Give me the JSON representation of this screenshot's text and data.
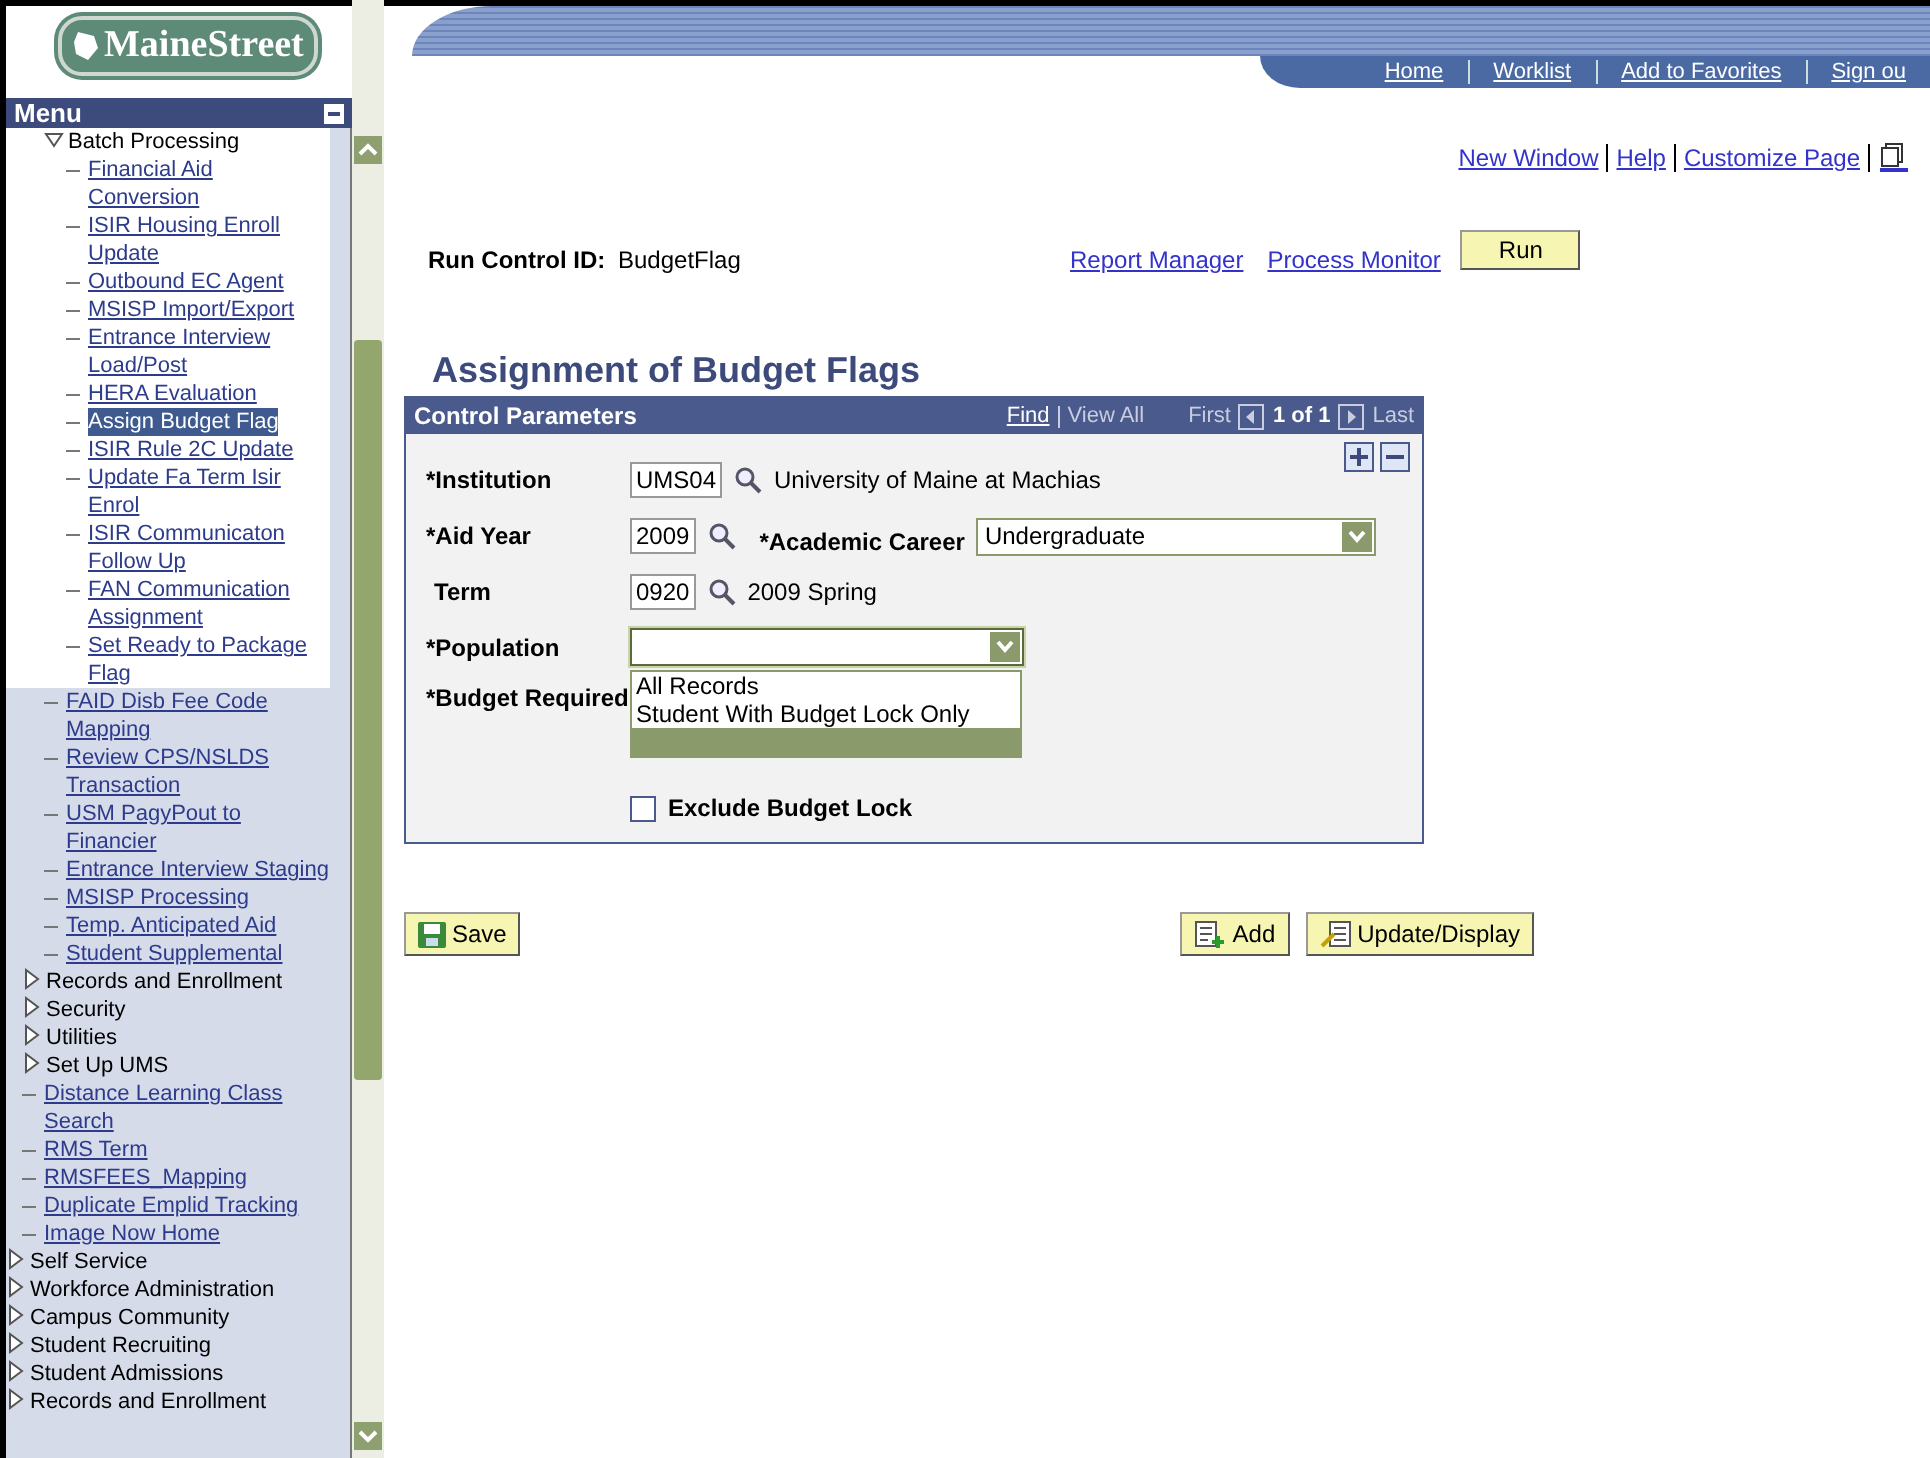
{
  "logo": {
    "text": "MaineStreet"
  },
  "header_nav": [
    "Home",
    "Worklist",
    "Add to Favorites",
    "Sign ou"
  ],
  "menu": {
    "title": "Menu",
    "items": [
      {
        "children": [
          {
            "children": [
              {
                "label": "Batch Processing",
                "kind": "folder",
                "expanded": true,
                "children": [
                  {
                    "label": "Financial Aid Conversion",
                    "kind": "link",
                    "selected": false
                  },
                  {
                    "label": "ISIR Housing Enroll Update",
                    "kind": "link",
                    "selected": false
                  },
                  {
                    "label": "Outbound EC Agent",
                    "kind": "link",
                    "selected": false
                  },
                  {
                    "label": "MSISP Import/Export",
                    "kind": "link",
                    "selected": false
                  },
                  {
                    "label": "Entrance Interview Load/Post",
                    "kind": "link",
                    "selected": false
                  },
                  {
                    "label": "HERA Evaluation",
                    "kind": "link",
                    "selected": false
                  },
                  {
                    "label": "Assign Budget Flag",
                    "kind": "link",
                    "selected": true
                  },
                  {
                    "label": "ISIR Rule 2C Update",
                    "kind": "link",
                    "selected": false
                  },
                  {
                    "label": "Update Fa Term Isir Enrol",
                    "kind": "link",
                    "selected": false
                  },
                  {
                    "label": "ISIR Communicaton Follow Up",
                    "kind": "link",
                    "selected": false
                  },
                  {
                    "label": "FAN Communication Assignment",
                    "kind": "link",
                    "selected": false
                  },
                  {
                    "label": "Set Ready to Package Flag",
                    "kind": "link",
                    "selected": false
                  }
                ]
              },
              {
                "label": "FAID Disb Fee Code Mapping",
                "kind": "link",
                "selected": false
              },
              {
                "label": "Review CPS/NSLDS Transaction",
                "kind": "link",
                "selected": false
              },
              {
                "label": "USM PagyPout to Financier",
                "kind": "link",
                "selected": false
              },
              {
                "label": "Entrance Interview Staging",
                "kind": "link",
                "selected": false
              },
              {
                "label": "MSISP Processing",
                "kind": "link",
                "selected": false
              },
              {
                "label": "Temp. Anticipated Aid",
                "kind": "link",
                "selected": false
              },
              {
                "label": "Student Supplemental",
                "kind": "link",
                "selected": false
              }
            ]
          },
          {
            "label": "Records and Enrollment",
            "kind": "folder",
            "expanded": false
          },
          {
            "label": "Security",
            "kind": "folder",
            "expanded": false
          },
          {
            "label": "Utilities",
            "kind": "folder",
            "expanded": false
          },
          {
            "label": "Set Up UMS",
            "kind": "folder",
            "expanded": false
          },
          {
            "label": "Distance Learning Class Search",
            "kind": "link",
            "selected": false
          },
          {
            "label": "RMS Term",
            "kind": "link",
            "selected": false
          },
          {
            "label": "RMSFEES_Mapping",
            "kind": "link",
            "selected": false
          },
          {
            "label": "Duplicate Emplid Tracking",
            "kind": "link",
            "selected": false
          },
          {
            "label": "Image Now Home",
            "kind": "link",
            "selected": false
          }
        ]
      },
      {
        "label": "Self Service",
        "kind": "folder",
        "expanded": false
      },
      {
        "label": "Workforce Administration",
        "kind": "folder",
        "expanded": false
      },
      {
        "label": "Campus Community",
        "kind": "folder",
        "expanded": false
      },
      {
        "label": "Student Recruiting",
        "kind": "folder",
        "expanded": false
      },
      {
        "label": "Student Admissions",
        "kind": "folder",
        "expanded": false
      },
      {
        "label": "Records and Enrollment",
        "kind": "folder",
        "expanded": false
      }
    ]
  },
  "page_links": [
    "New Window",
    "Help",
    "Customize Page"
  ],
  "run_control": {
    "label": "Run Control ID:",
    "value": "BudgetFlag",
    "links": [
      "Report Manager",
      "Process Monitor"
    ],
    "run_button": "Run"
  },
  "page_title": "Assignment of Budget Flags",
  "control_parameters": {
    "title": "Control Parameters",
    "nav": {
      "find": "Find",
      "view_all": "View All",
      "first": "First",
      "count": "1 of 1",
      "last": "Last"
    },
    "institution": {
      "label": "*Institution",
      "value": "UMS04",
      "description": "University of Maine at Machias"
    },
    "aid_year": {
      "label": "*Aid Year",
      "value": "2009"
    },
    "academic_career": {
      "label": "*Academic Career",
      "value": "Undergraduate"
    },
    "term": {
      "label": "Term",
      "value": "0920",
      "description": "2009 Spring"
    },
    "population": {
      "label": "*Population",
      "expanded": true,
      "options": [
        {
          "label": "All Records",
          "selected": false
        },
        {
          "label": "Student With Budget Lock Only",
          "selected": false
        },
        {
          "selected": true
        }
      ]
    },
    "budget_required": {
      "label": "*Budget Required"
    },
    "exclude_budget_lock": {
      "label": "Exclude Budget Lock",
      "checked": false
    }
  },
  "buttons": {
    "save": "Save",
    "add": "Add",
    "update": "Update/Display"
  }
}
